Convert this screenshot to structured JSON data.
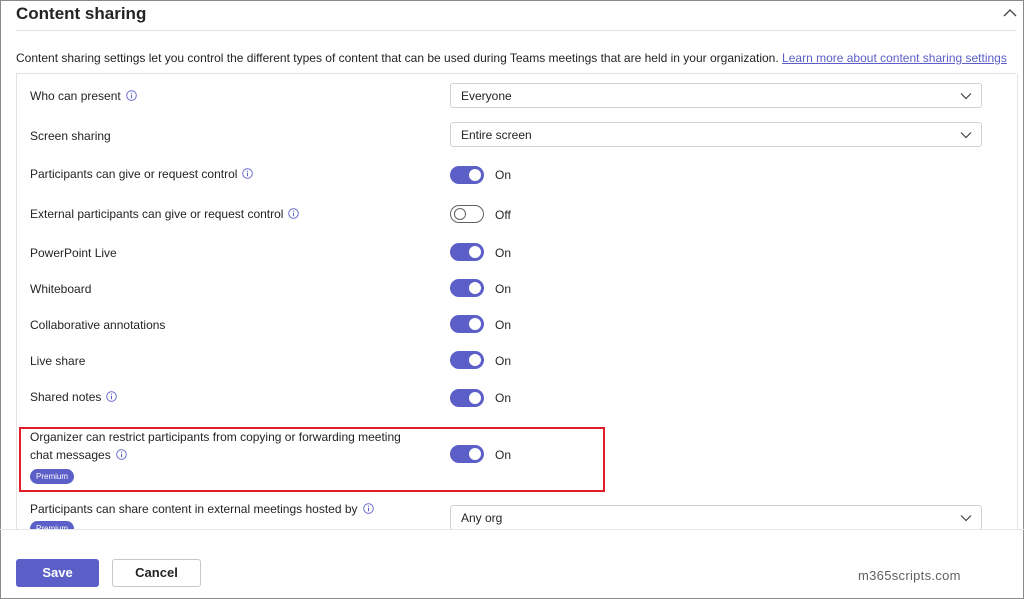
{
  "section": {
    "title": "Content sharing",
    "description": "Content sharing settings let you control the different types of content that can be used during Teams meetings that are held in your organization.",
    "learn_more": "Learn more about content sharing settings"
  },
  "settings": [
    {
      "label": "Who can present",
      "info": true,
      "control": "dropdown",
      "value": "Everyone"
    },
    {
      "label": "Screen sharing",
      "info": false,
      "control": "dropdown",
      "value": "Entire screen"
    },
    {
      "label": "Participants can give or request control",
      "info": true,
      "control": "toggle",
      "state": "On"
    },
    {
      "label": "External participants can give or request control",
      "info": true,
      "control": "toggle",
      "state": "Off"
    },
    {
      "label": "PowerPoint Live",
      "info": false,
      "control": "toggle",
      "state": "On"
    },
    {
      "label": "Whiteboard",
      "info": false,
      "control": "toggle",
      "state": "On"
    },
    {
      "label": "Collaborative annotations",
      "info": false,
      "control": "toggle",
      "state": "On"
    },
    {
      "label": "Live share",
      "info": false,
      "control": "toggle",
      "state": "On"
    },
    {
      "label": "Shared notes",
      "info": true,
      "control": "toggle",
      "state": "On"
    },
    {
      "label_line1": "Organizer can restrict participants from copying or forwarding meeting",
      "label_line2": "chat messages",
      "info": true,
      "badge": "Premium",
      "control": "toggle",
      "state": "On"
    },
    {
      "label": "Participants can share content in external meetings hosted by",
      "info": true,
      "badge": "Premium",
      "control": "dropdown",
      "value": "Any org"
    }
  ],
  "footer": {
    "save_label": "Save",
    "cancel_label": "Cancel"
  },
  "watermark": "m365scripts.com",
  "colors": {
    "accent": "#5b5fc7",
    "highlight": "#e11d2c"
  }
}
